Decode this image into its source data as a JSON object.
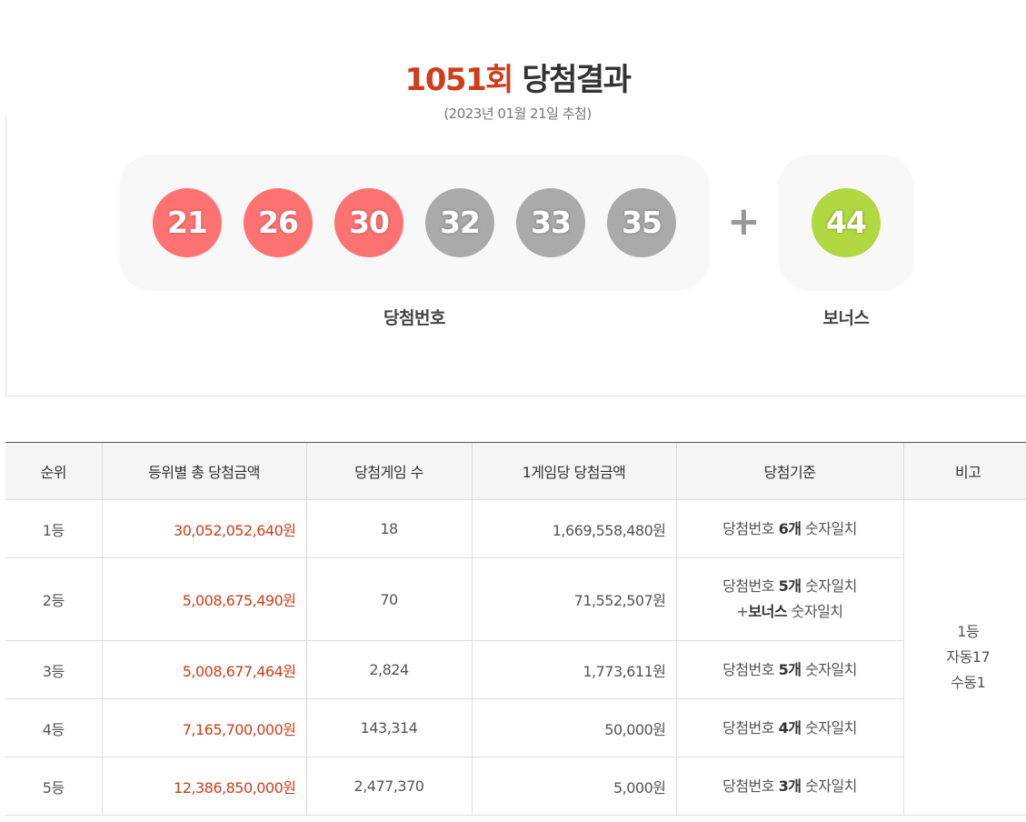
{
  "header": {
    "round": "1051회",
    "title": "당첨결과",
    "date": "(2023년 01월 21일 추첨)"
  },
  "winning_numbers": {
    "balls": [
      "21",
      "26",
      "30",
      "32",
      "33",
      "35"
    ],
    "plus": "+",
    "bonus": "44",
    "label": "당첨번호",
    "bonus_label": "보너스"
  },
  "table": {
    "headers": [
      "순위",
      "등위별 총 당첨금액",
      "당첨게임 수",
      "1게임당 당첨금액",
      "당첨기준",
      "비고"
    ],
    "rows": [
      {
        "rank": "1등",
        "total": "30,052,052,640원",
        "count": "18",
        "per_game": "1,669,558,480원",
        "crit_pre": "당첨번호 ",
        "crit_bold": "6개",
        "crit_post": " 숫자일치"
      },
      {
        "rank": "2등",
        "total": "5,008,675,490원",
        "count": "70",
        "per_game": "71,552,507원",
        "crit_pre": "당첨번호 ",
        "crit_bold": "5개",
        "crit_post": " 숫자일치",
        "crit2_pre": "+",
        "crit2_bold": "보너스",
        "crit2_post": " 숫자일치"
      },
      {
        "rank": "3등",
        "total": "5,008,677,464원",
        "count": "2,824",
        "per_game": "1,773,611원",
        "crit_pre": "당첨번호 ",
        "crit_bold": "5개",
        "crit_post": " 숫자일치"
      },
      {
        "rank": "4등",
        "total": "7,165,700,000원",
        "count": "143,314",
        "per_game": "50,000원",
        "crit_pre": "당첨번호 ",
        "crit_bold": "4개",
        "crit_post": " 숫자일치"
      },
      {
        "rank": "5등",
        "total": "12,386,850,000원",
        "count": "2,477,370",
        "per_game": "5,000원",
        "crit_pre": "당첨번호 ",
        "crit_bold": "3개",
        "crit_post": " 숫자일치"
      }
    ],
    "note": [
      "1등",
      "자동17",
      "수동1"
    ]
  },
  "colors": {
    "accent": "#cf3d1b",
    "ball_red": "#ff7272",
    "ball_gray": "#aaaaaa",
    "ball_bonus": "#b0d840"
  }
}
